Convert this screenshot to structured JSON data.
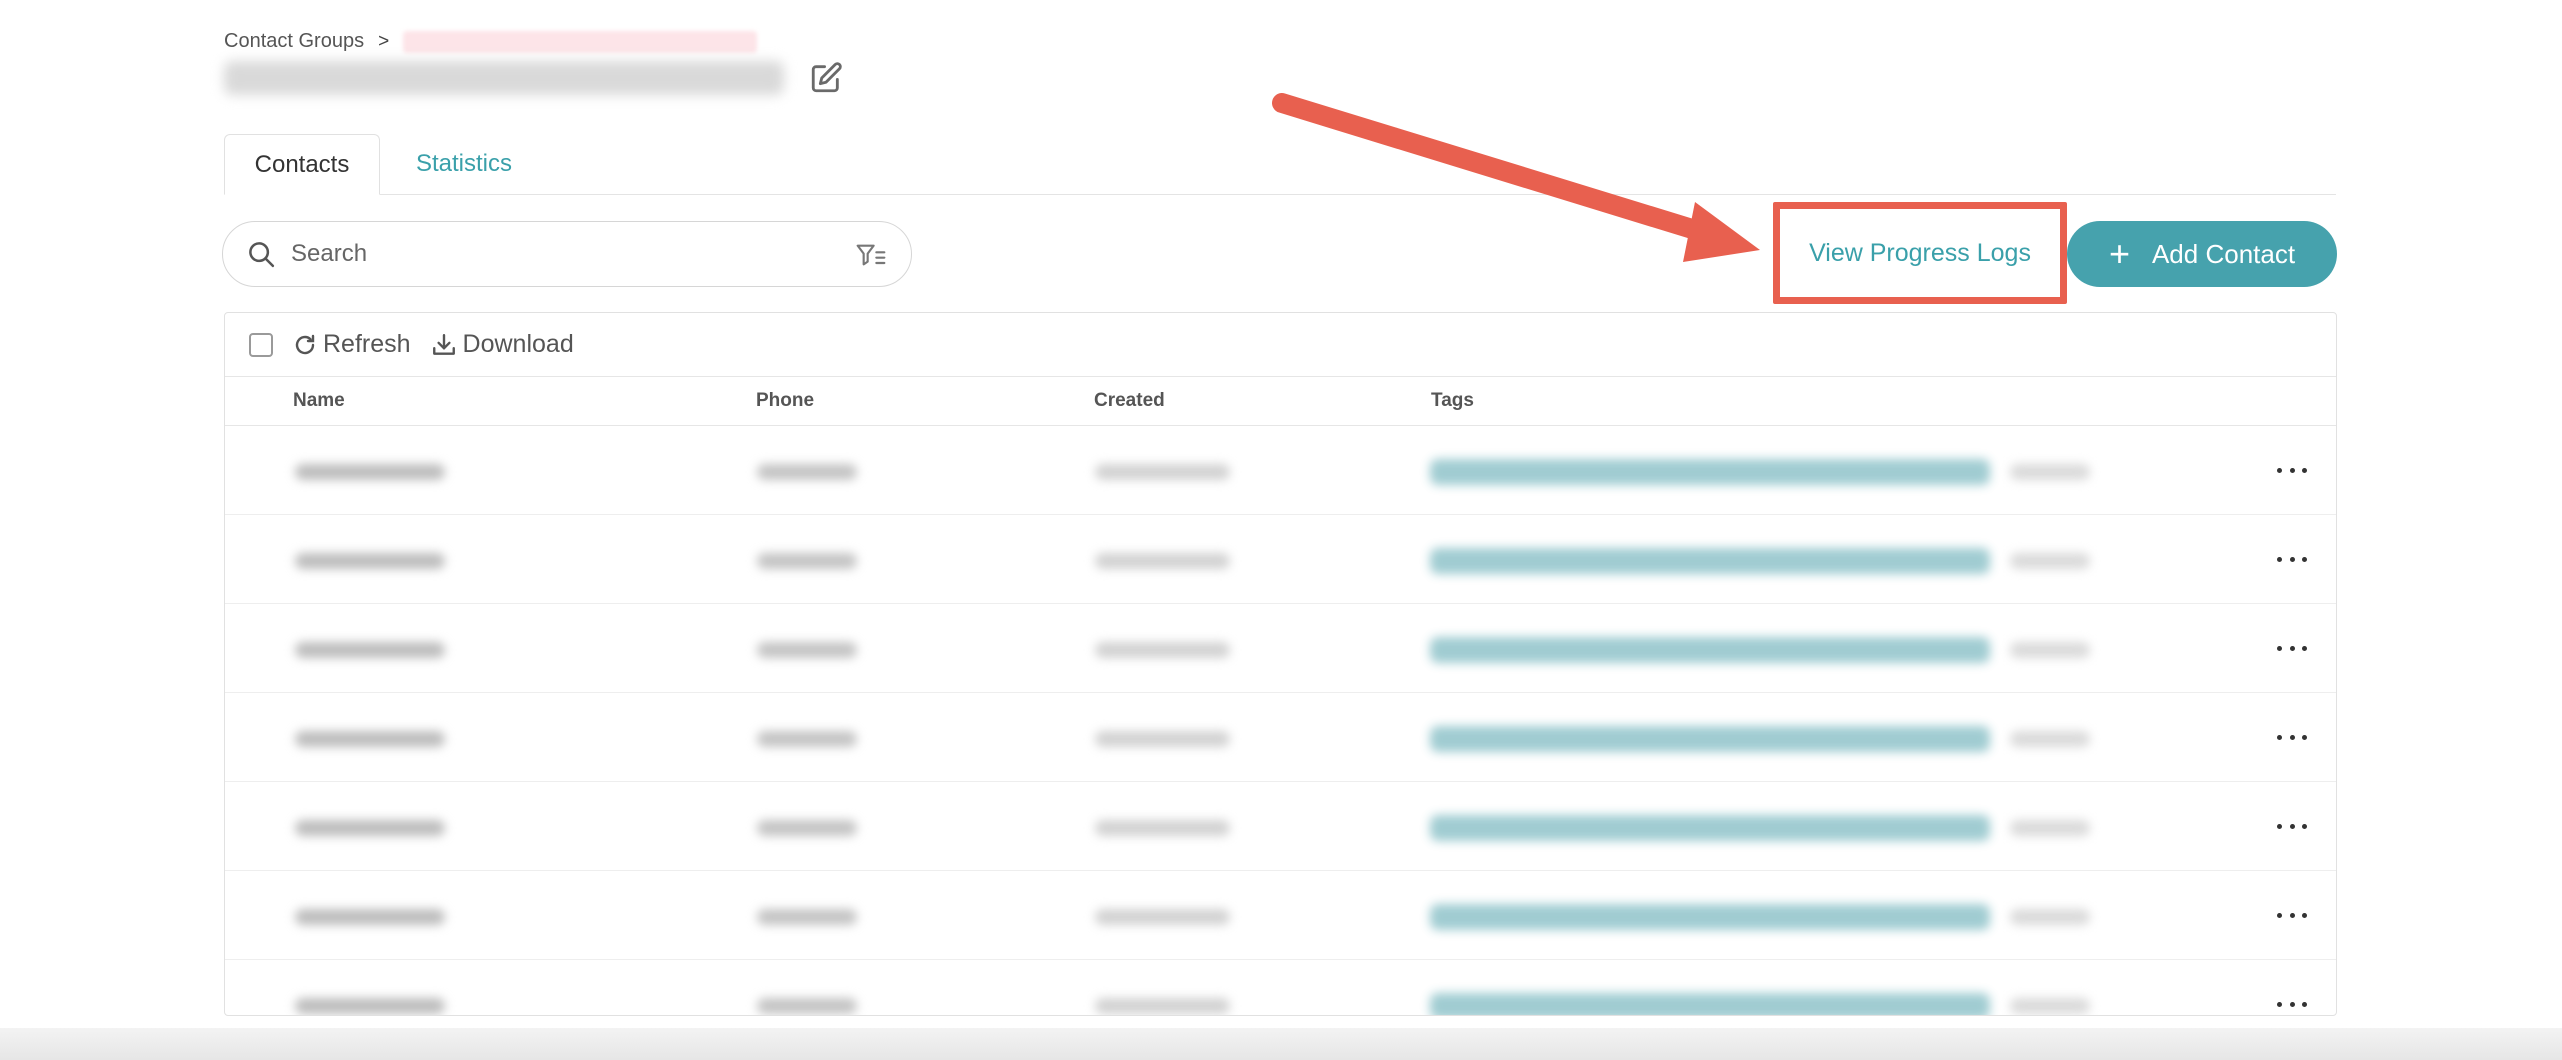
{
  "breadcrumb": {
    "root": "Contact Groups",
    "separator": ">"
  },
  "tabs": [
    {
      "label": "Contacts"
    },
    {
      "label": "Statistics"
    }
  ],
  "search": {
    "placeholder": "Search"
  },
  "actions": {
    "progress_logs": "View Progress Logs",
    "add_contact": "Add Contact"
  },
  "toolbar": {
    "refresh": "Refresh",
    "download": "Download"
  },
  "table": {
    "columns": [
      "Name",
      "Phone",
      "Created",
      "Tags"
    ],
    "row_count": 7
  },
  "colors": {
    "accent": "#46a2ad",
    "link": "#3aa0aa",
    "annotation": "#e8604f"
  }
}
